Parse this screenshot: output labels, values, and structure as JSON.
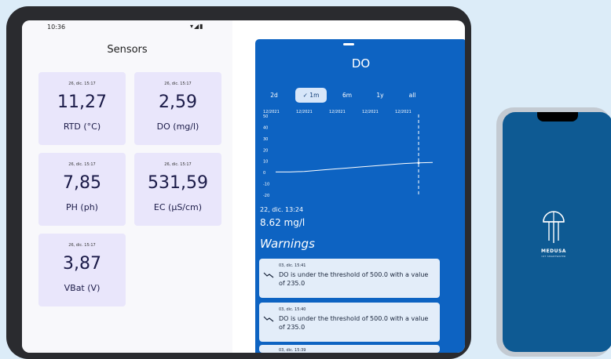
{
  "status": {
    "time": "10:36",
    "icons": "▾◢▮"
  },
  "sensors": {
    "title": "Sensors",
    "cards": [
      {
        "timestamp": "26, dic. 15:17",
        "value": "11,27",
        "label": "RTD (°C)"
      },
      {
        "timestamp": "26, dic. 15:17",
        "value": "2,59",
        "label": "DO (mg/l)"
      },
      {
        "timestamp": "26, dic. 15:17",
        "value": "7,85",
        "label": "PH (ph)"
      },
      {
        "timestamp": "26, dic. 15:17",
        "value": "531,59",
        "label": "EC (μS/cm)"
      },
      {
        "timestamp": "26, dic. 15:17",
        "value": "3,87",
        "label": "VBat (V)"
      }
    ]
  },
  "detail": {
    "title": "DO",
    "ranges": [
      "2d",
      "✓ 1m",
      "6m",
      "1y",
      "all"
    ],
    "selected_range": "1m",
    "readout_timestamp": "22, dic. 13:24",
    "readout_value": "8.62 mg/l",
    "warnings_title": "Warnings",
    "warnings": [
      {
        "timestamp": "03, dic. 15:41",
        "message": "DO is under the threshold of 500.0 with a value of 235.0"
      },
      {
        "timestamp": "03, dic. 15:40",
        "message": "DO is under the threshold of 500.0 with a value of 235.0"
      },
      {
        "timestamp": "03, dic. 15:39",
        "message": ""
      }
    ]
  },
  "chart_data": {
    "type": "line",
    "x_labels": [
      "12/2021",
      "12/2021",
      "12/2021",
      "12/2021",
      "12/2021"
    ],
    "y_ticks": [
      50,
      40,
      30,
      20,
      10,
      0,
      -10,
      -20
    ],
    "ylim": [
      -20,
      50
    ],
    "series": [
      {
        "values": [
          0.5,
          0.5,
          1,
          2,
          3,
          4,
          5,
          6,
          7,
          8,
          8.62,
          9
        ]
      }
    ],
    "cursor_value": 8.62,
    "colors": {
      "line": "#ffffff",
      "axis_text": "#ffffff"
    }
  },
  "phone": {
    "brand": "MEDUSA",
    "brand_sub": "IOT SMARTWATER"
  }
}
